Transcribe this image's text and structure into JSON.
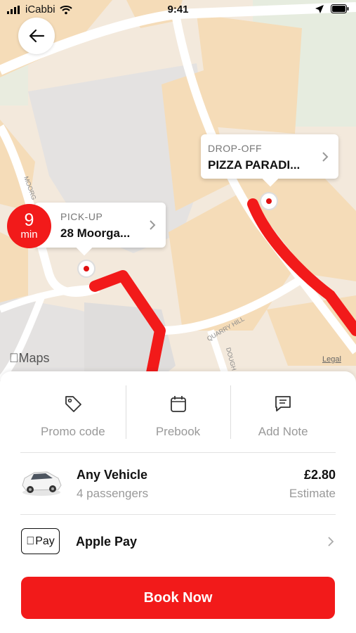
{
  "status_bar": {
    "carrier": "iCabbi",
    "time": "9:41"
  },
  "map": {
    "provider_label": "Maps",
    "legal_label": "Legal",
    "street_labels": [
      "QUARRY HILL",
      "MOORG",
      "DOUGH"
    ],
    "dropoff": {
      "label": "DROP-OFF",
      "value": "PIZZA PARADI..."
    },
    "pickup": {
      "label": "PICK-UP",
      "value": "28 Moorga..."
    },
    "eta": {
      "number": "9",
      "unit": "min"
    },
    "route_color": "#f21a1a"
  },
  "actions": [
    {
      "label": "Promo code",
      "icon": "tag-icon"
    },
    {
      "label": "Prebook",
      "icon": "calendar-icon"
    },
    {
      "label": "Add Note",
      "icon": "note-icon"
    }
  ],
  "vehicle": {
    "name": "Any Vehicle",
    "passengers": "4 passengers",
    "price": "£2.80",
    "price_note": "Estimate"
  },
  "payment": {
    "badge_text": "Pay",
    "label": "Apple Pay"
  },
  "book_button": {
    "label": "Book Now"
  },
  "colors": {
    "accent": "#f21a1a"
  }
}
